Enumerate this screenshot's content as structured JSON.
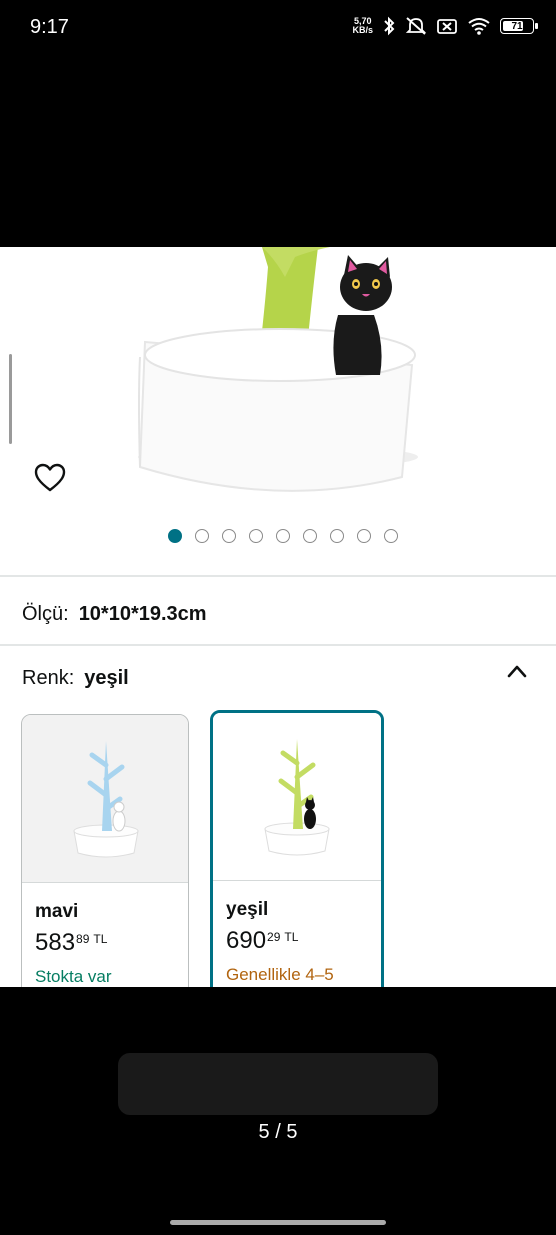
{
  "status_bar": {
    "time": "9:17",
    "net_speed_value": "5,70",
    "net_speed_unit": "KB/s",
    "battery": "71",
    "icons": [
      "bluetooth-icon",
      "mute-icon",
      "sim-off-icon",
      "wifi-icon",
      "battery-icon"
    ]
  },
  "product": {
    "image_name": "cat-tree-jewelry-holder",
    "carousel": {
      "total": 9,
      "active_index": 0
    }
  },
  "size": {
    "label": "Ölçü:",
    "value": "10*10*19.3cm"
  },
  "color": {
    "label": "Renk:",
    "value": "yeşil",
    "options": [
      {
        "name": "mavi",
        "price_whole": "583",
        "price_frac": "89",
        "currency": "TL",
        "stock": "Stokta var",
        "stock_color": "#067d62",
        "tree_color": "#a8d4ef",
        "cat_color": "#ffffff"
      },
      {
        "name": "yeşil",
        "price_whole": "690",
        "price_frac": "29",
        "currency": "TL",
        "stock": "Genellikle 4–5",
        "stock_color": "#b1640f",
        "tree_color": "#c3dc63",
        "cat_color": "#111111"
      }
    ]
  },
  "viewer": {
    "page_counter": "5 / 5"
  },
  "colors": {
    "accent": "#007185",
    "background": "#000000"
  }
}
